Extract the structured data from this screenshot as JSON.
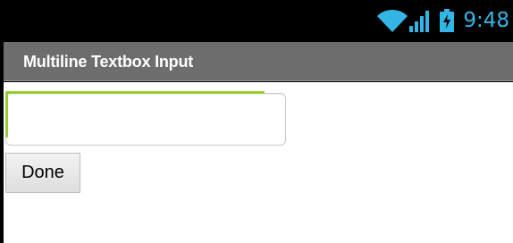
{
  "status_bar": {
    "time": "9:48",
    "icons": [
      "wifi-icon",
      "signal-icon",
      "battery-charging-icon"
    ],
    "accent_color": "#33b5e5"
  },
  "action_bar": {
    "title": "Multiline Textbox Input",
    "background_color": "#6d6d6d"
  },
  "form": {
    "textbox": {
      "value": "",
      "placeholder": "",
      "focus_color": "#99cc33"
    },
    "done_label": "Done"
  }
}
